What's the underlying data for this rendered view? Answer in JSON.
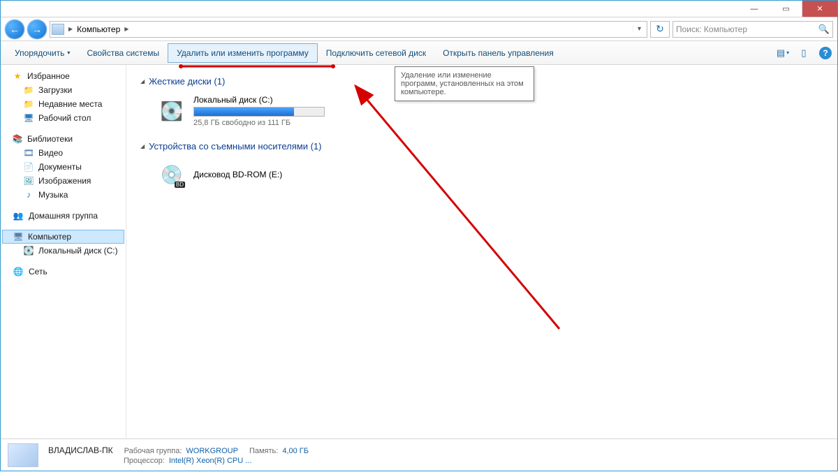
{
  "window": {
    "title": "Компьютер"
  },
  "nav": {
    "breadcrumb": "Компьютер",
    "search_placeholder": "Поиск: Компьютер"
  },
  "cmdbar": {
    "organize": "Упорядочить",
    "system_props": "Свойства системы",
    "uninstall": "Удалить или изменить программу",
    "map_drive": "Подключить сетевой диск",
    "control_panel": "Открыть панель управления"
  },
  "tooltip": "Удаление или изменение программ, установленных на этом компьютере.",
  "sidebar": {
    "favorites": "Избранное",
    "downloads": "Загрузки",
    "recent": "Недавние места",
    "desktop": "Рабочий стол",
    "libraries": "Библиотеки",
    "video": "Видео",
    "documents": "Документы",
    "pictures": "Изображения",
    "music": "Музыка",
    "homegroup": "Домашняя группа",
    "computer": "Компьютер",
    "local_c": "Локальный диск (C:)",
    "network": "Сеть"
  },
  "sections": {
    "hdd": "Жесткие диски (1)",
    "removable": "Устройства со съемными носителями (1)"
  },
  "drive_c": {
    "name": "Локальный диск (C:)",
    "free_text": "25,8 ГБ свободно из 111 ГБ"
  },
  "bd": {
    "name": "Дисковод BD-ROM (E:)",
    "badge": "BD"
  },
  "details": {
    "pc_name": "ВЛАДИСЛАВ-ПК",
    "workgroup_label": "Рабочая группа:",
    "workgroup_value": "WORKGROUP",
    "memory_label": "Память:",
    "memory_value": "4,00 ГБ",
    "cpu_label": "Процессор:",
    "cpu_value": "Intel(R) Xeon(R) CPU    ..."
  }
}
